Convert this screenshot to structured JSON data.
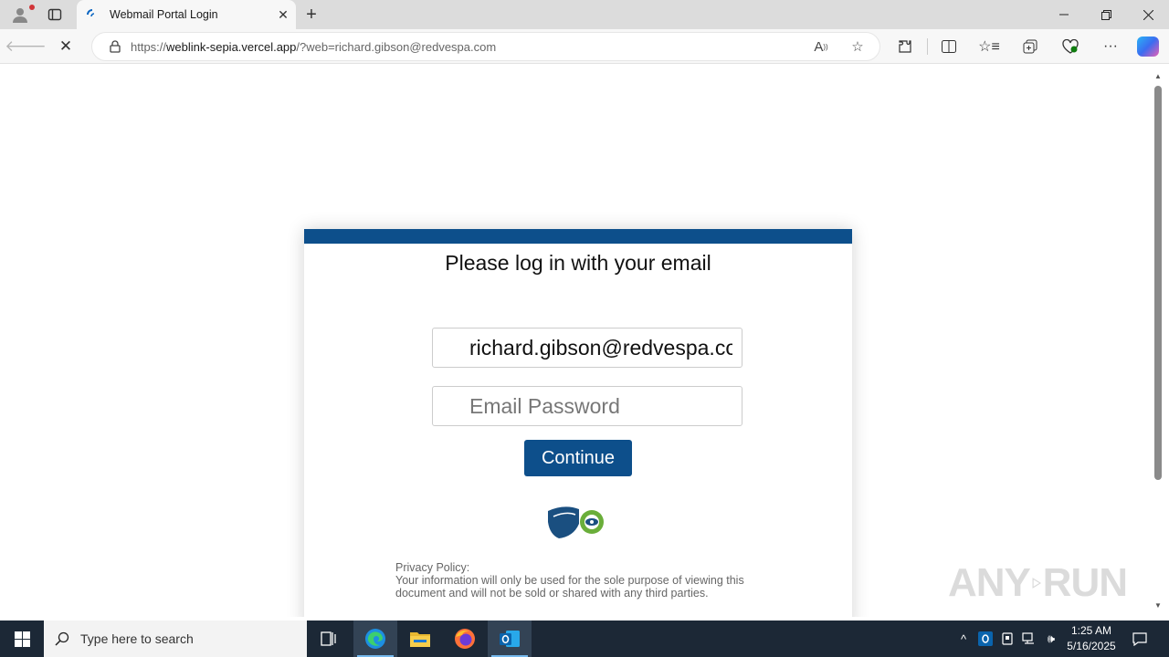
{
  "browser": {
    "tab_title": "Webmail Portal Login",
    "url_prefix": "https://",
    "url_host": "weblink-sepia.vercel.app",
    "url_rest": "/?web=richard.gibson@redvespa.com"
  },
  "page": {
    "heading": "Please log in with your email",
    "email_value": "richard.gibson@redvespa.com",
    "password_placeholder": "Email Password",
    "continue_label": "Continue",
    "privacy_heading": "Privacy Policy:",
    "privacy_text": "Your information will only be used for the sole purpose of viewing this document and will not be sold or shared with any third parties.",
    "accent_color": "#0d4f8b"
  },
  "watermark": {
    "left": "ANY",
    "right": "RUN"
  },
  "taskbar": {
    "search_placeholder": "Type here to search",
    "time": "1:25 AM",
    "date": "5/16/2025"
  }
}
